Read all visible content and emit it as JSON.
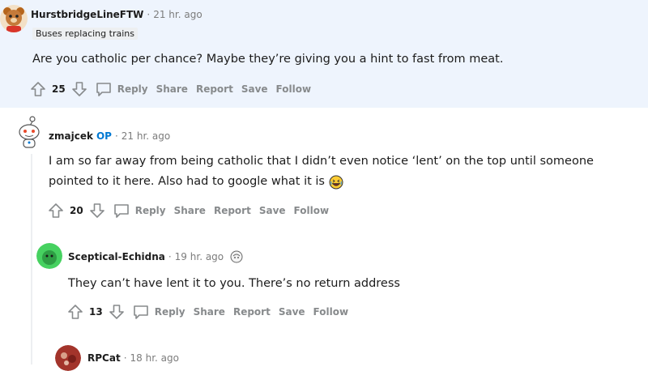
{
  "comments": [
    {
      "author": "HurstbridgeLineFTW",
      "time": "21 hr. ago",
      "flair": "Buses replacing trains",
      "body": "Are you catholic per chance? Maybe they’re giving you a hint to fast from meat.",
      "votes": "25",
      "actions": [
        "Reply",
        "Share",
        "Report",
        "Save",
        "Follow"
      ]
    },
    {
      "author": "zmajcek",
      "op": "OP",
      "time": "21 hr. ago",
      "body_line1": "I am so far away from being catholic that I didn’t even notice ‘lent’ on the top until someone",
      "body_line2": "pointed to it here. Also had to google what it is",
      "emoji": "laughing-emoji",
      "votes": "20",
      "actions": [
        "Reply",
        "Share",
        "Report",
        "Save",
        "Follow"
      ]
    },
    {
      "author": "Sceptical-Echidna",
      "time": "19 hr. ago",
      "body": "They can’t have lent it to you. There’s no return address",
      "votes": "13",
      "actions": [
        "Reply",
        "Share",
        "Report",
        "Save",
        "Follow"
      ]
    },
    {
      "author": "RPCat",
      "time": "18 hr. ago"
    }
  ],
  "separator": "·",
  "colors": {
    "highlight_bg": "#eef4fd",
    "op_blue": "#0079d3",
    "muted": "#878a8c"
  }
}
